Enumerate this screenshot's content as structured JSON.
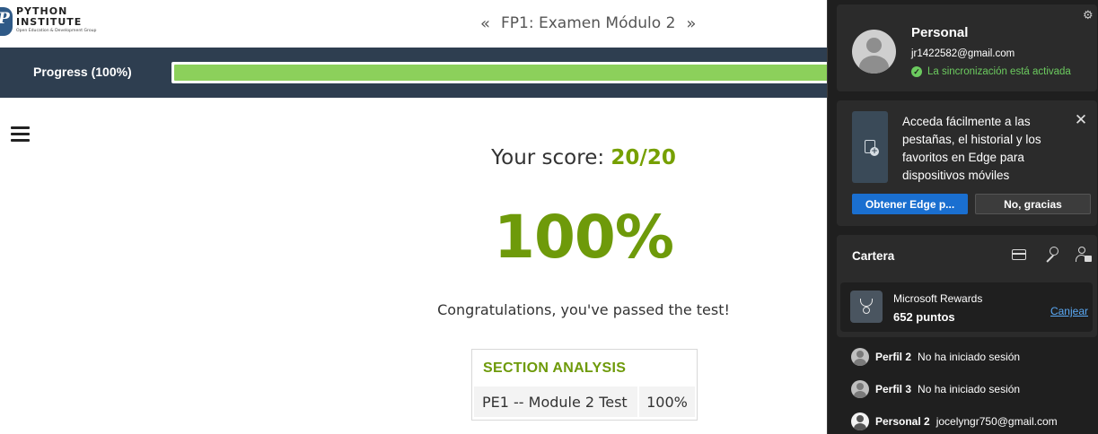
{
  "logo": {
    "mark": "P",
    "line1": "PYTHON",
    "line2": "INSTITUTE",
    "tagline": "Open Education & Development Group"
  },
  "nav": {
    "prev": "«",
    "title": "FP1: Examen Módulo 2",
    "next": "»"
  },
  "progress": {
    "label": "Progress (100%)",
    "value_percent": 100,
    "fill_color": "#8cd05b"
  },
  "result": {
    "score_prefix": "Your score: ",
    "score_value": "20/20",
    "percent": "100%",
    "message": "Congratulations, you've passed the test!",
    "accent_color": "#6e9a0a"
  },
  "section_analysis": {
    "heading": "SECTION ANALYSIS",
    "rows": [
      {
        "name": "PE1 -- Module 2 Test",
        "value": "100%"
      }
    ]
  },
  "edge_flyout": {
    "profile": {
      "name": "Personal",
      "email": "jr1422582@gmail.com",
      "sync_status": "La sincronización está activada",
      "settings_icon": "gear-icon"
    },
    "promo": {
      "text": "Acceda fácilmente a las pestañas, el historial y los favoritos en Edge para dispositivos móviles",
      "primary_button": "Obtener Edge p...",
      "secondary_button": "No, gracias",
      "close_icon": "close-icon"
    },
    "wallet": {
      "title": "Cartera",
      "icons": [
        "card-icon",
        "key-icon",
        "person-lock-icon"
      ],
      "rewards_name": "Microsoft Rewards",
      "rewards_points": "652 puntos",
      "rewards_link": "Canjear"
    },
    "other_profiles": [
      {
        "name": "Perfil 2",
        "status": "No ha iniciado sesión"
      },
      {
        "name": "Perfil 3",
        "status": "No ha iniciado sesión"
      },
      {
        "name": "Personal 2",
        "status": "jocelyngr750@gmail.com"
      }
    ]
  }
}
